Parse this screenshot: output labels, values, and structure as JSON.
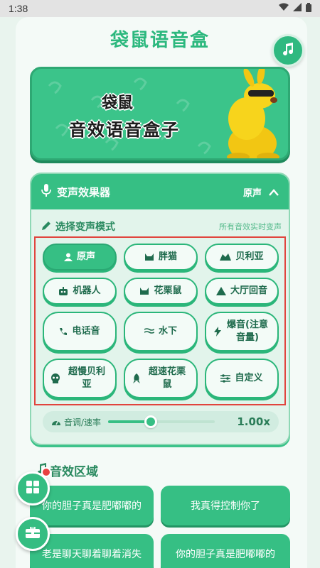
{
  "status_bar": {
    "time": "1:38"
  },
  "app": {
    "title": "袋鼠语音盒"
  },
  "banner": {
    "line1": "袋鼠",
    "line2": "音效语音盒子"
  },
  "voice_panel": {
    "title": "变声效果器",
    "current_mode": "原声",
    "select_label": "选择变声模式",
    "hint": "所有音效实时变声",
    "modes": [
      {
        "label": "原声",
        "icon": "person-icon",
        "active": true
      },
      {
        "label": "胖猫",
        "icon": "cat-icon",
        "active": false
      },
      {
        "label": "贝利亚",
        "icon": "monster-icon",
        "active": false
      },
      {
        "label": "机器人",
        "icon": "robot-icon",
        "active": false
      },
      {
        "label": "花栗鼠",
        "icon": "chipmunk-icon",
        "active": false
      },
      {
        "label": "大厅回音",
        "icon": "hall-icon",
        "active": false
      },
      {
        "label": "电话音",
        "icon": "phone-icon",
        "active": false
      },
      {
        "label": "水下",
        "icon": "water-icon",
        "active": false
      },
      {
        "label": "爆音(注意音量)",
        "icon": "lightning-icon",
        "active": false
      },
      {
        "label": "超慢贝利亚",
        "icon": "skull-icon",
        "active": false
      },
      {
        "label": "超速花栗鼠",
        "icon": "rocket-icon",
        "active": false
      },
      {
        "label": "自定义",
        "icon": "sliders-icon",
        "active": false
      }
    ],
    "speed": {
      "label": "音调/速率",
      "value_text": "1.00x",
      "level": 0.4
    }
  },
  "sfx_section": {
    "title": "音效区域",
    "items": [
      "你的胆子真是肥嘟嘟的",
      "我真得控制你了",
      "老是聊天聊着聊着消失",
      "你的胆子真是肥嘟嘟的"
    ]
  },
  "colors": {
    "accent": "#36bf84",
    "title": "#2cb87e",
    "highlight_border": "#e1443d"
  }
}
